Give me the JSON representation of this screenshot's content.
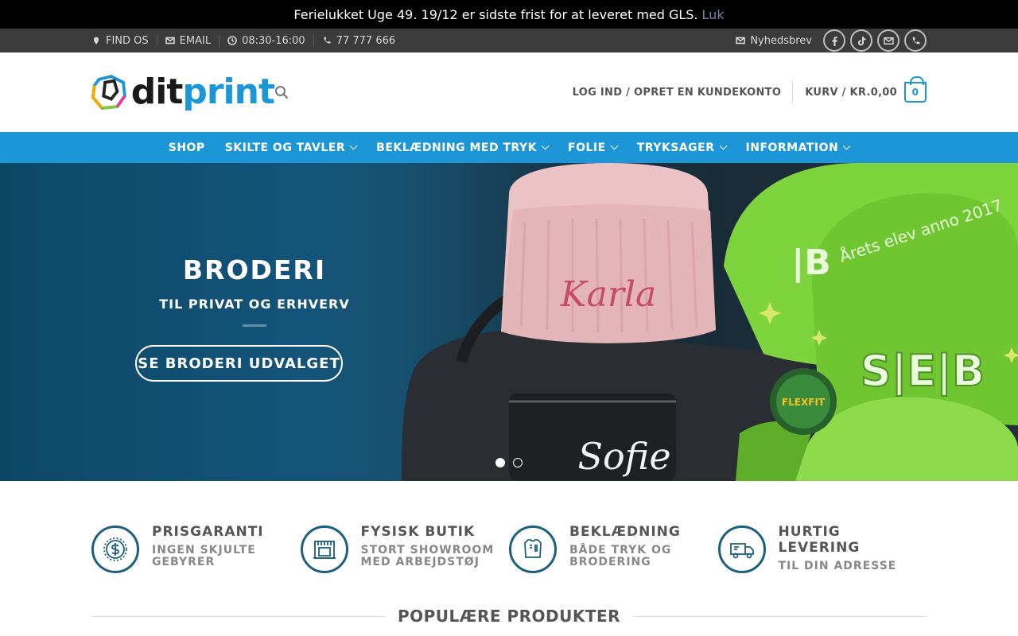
{
  "notice": {
    "text": "Ferielukket Uge 49. 19/12 er sidste frist for at leveret med GLS.",
    "link": "Luk"
  },
  "topbar": {
    "find": "FIND OS",
    "email": "EMAIL",
    "hours": "08:30-16:00",
    "phone": "77 777 666",
    "newsletter": "Nyhedsbrev",
    "socials": [
      "facebook-icon",
      "tiktok-icon",
      "email-icon",
      "phone-icon"
    ]
  },
  "header": {
    "logo_dit": "dit",
    "logo_print": "print",
    "login": "LOG IND / OPRET EN KUNDEKONTO",
    "cart": "KURV / KR.0,00",
    "cart_count": "0"
  },
  "nav": [
    {
      "label": "SHOP",
      "dropdown": false
    },
    {
      "label": "SKILTE OG TAVLER",
      "dropdown": true
    },
    {
      "label": "BEKLÆDNING MED TRYK",
      "dropdown": true
    },
    {
      "label": "FOLIE",
      "dropdown": true
    },
    {
      "label": "TRYKSAGER",
      "dropdown": true
    },
    {
      "label": "INFORMATION",
      "dropdown": true
    }
  ],
  "hero": {
    "title": "BRODERI",
    "subtitle": "TIL PRIVAT OG ERHVERV",
    "button": "SE BRODERI UDVALGET",
    "image_texts": {
      "beanie": "Karla",
      "bag": "Sofie",
      "cap_logo": "S|E|B",
      "cap_text": "Årets elev anno 2017"
    },
    "slide_count": 2,
    "active_slide": 1
  },
  "features": [
    {
      "icon": "dollar-icon",
      "title": "PRISGARANTI",
      "sub1": "INGEN SKJULTE",
      "sub2": "GEBYRER"
    },
    {
      "icon": "shop-icon",
      "title": "FYSISK BUTIK",
      "sub1": "STORT SHOWROOM",
      "sub2": "MED ARBEJDSTØJ"
    },
    {
      "icon": "shirt-icon",
      "title": "BEKLÆDNING",
      "sub1": "BÅDE TRYK OG",
      "sub2": "BRODERING"
    },
    {
      "icon": "truck-icon",
      "title": "HURTIG LEVERING",
      "sub1": "TIL DIN ADRESSE",
      "sub2": ""
    }
  ],
  "section_title": "POPULÆRE PRODUKTER",
  "colors": {
    "primary": "#1c96d6",
    "icon": "#1c5f7f",
    "topbar": "#3b3b3b"
  }
}
